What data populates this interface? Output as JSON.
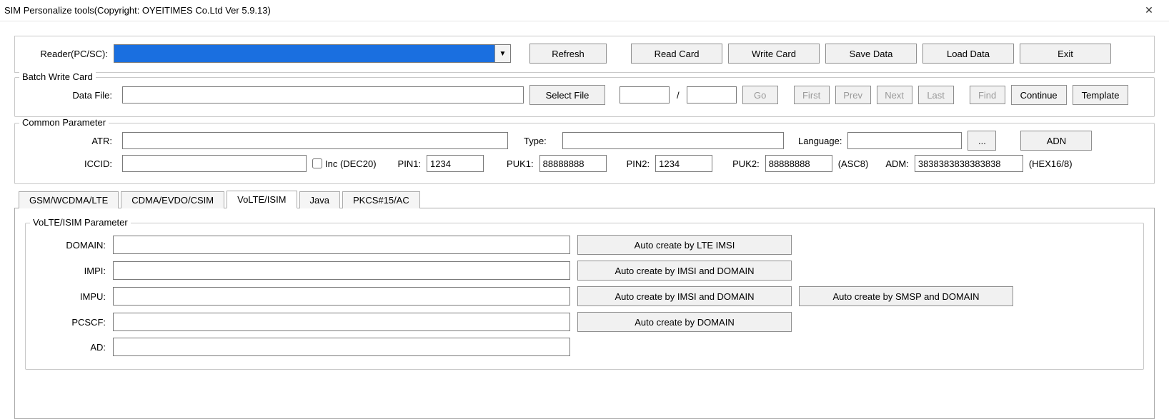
{
  "window": {
    "title": "SIM Personalize tools(Copyright: OYEITIMES Co.Ltd  Ver 5.9.13)"
  },
  "reader": {
    "label": "Reader(PC/SC):",
    "selected": "",
    "buttons": {
      "refresh": "Refresh",
      "readcard": "Read Card",
      "writecard": "Write Card",
      "savedata": "Save Data",
      "loaddata": "Load Data",
      "exit": "Exit"
    }
  },
  "batch": {
    "legend": "Batch Write Card",
    "datafile_label": "Data File:",
    "datafile": "",
    "selectfile": "Select File",
    "pos_a": "",
    "pos_b": "",
    "go": "Go",
    "first": "First",
    "prev": "Prev",
    "next": "Next",
    "last": "Last",
    "find": "Find",
    "continue": "Continue",
    "template": "Template"
  },
  "common": {
    "legend": "Common Parameter",
    "atr_label": "ATR:",
    "atr": "",
    "type_label": "Type:",
    "type": "",
    "language_label": "Language:",
    "language": "",
    "lang_browse": "...",
    "adn": "ADN",
    "iccid_label": "ICCID:",
    "iccid": "",
    "inc_label": "Inc  (DEC20)",
    "pin1_label": "PIN1:",
    "pin1": "1234",
    "puk1_label": "PUK1:",
    "puk1": "88888888",
    "pin2_label": "PIN2:",
    "pin2": "1234",
    "puk2_label": "PUK2:",
    "puk2": "88888888",
    "asc8": "(ASC8)",
    "adm_label": "ADM:",
    "adm": "3838383838383838",
    "hex": "(HEX16/8)"
  },
  "tabs": {
    "gsm": "GSM/WCDMA/LTE",
    "cdma": "CDMA/EVDO/CSIM",
    "volte": "VoLTE/ISIM",
    "java": "Java",
    "pkcs": "PKCS#15/AC"
  },
  "volte": {
    "legend": "VoLTE/ISIM  Parameter",
    "domain_label": "DOMAIN:",
    "domain": "",
    "impi_label": "IMPI:",
    "impi": "",
    "impu_label": "IMPU:",
    "impu": "",
    "pcscf_label": "PCSCF:",
    "pcscf": "",
    "ad_label": "AD:",
    "ad": "",
    "btn_domain": "Auto create by LTE IMSI",
    "btn_impi": "Auto create by IMSI and DOMAIN",
    "btn_impu1": "Auto create by IMSI and DOMAIN",
    "btn_impu2": "Auto create by SMSP and DOMAIN",
    "btn_pcscf": "Auto create by DOMAIN"
  }
}
